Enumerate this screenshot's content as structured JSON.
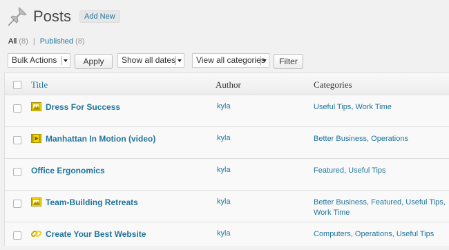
{
  "header": {
    "title": "Posts",
    "add_new": "Add New"
  },
  "views": {
    "all_label": "All",
    "all_count": "(8)",
    "separator": "|",
    "published_label": "Published",
    "published_count": "(8)"
  },
  "toolbar": {
    "bulk_actions": "Bulk Actions",
    "apply": "Apply",
    "dates": "Show all dates",
    "categories": "View all categories",
    "filter": "Filter"
  },
  "columns": {
    "title": "Title",
    "author": "Author",
    "categories": "Categories"
  },
  "posts": [
    {
      "title": "Dress For Success",
      "author": "kyla",
      "categories": "Useful Tips, Work Time",
      "format_icon": "image-format-icon"
    },
    {
      "title": "Manhattan In Motion (video)",
      "author": "kyla",
      "categories": "Better Business, Operations",
      "format_icon": "video-format-icon"
    },
    {
      "title": "Office Ergonomics",
      "author": "kyla",
      "categories": "Featured, Useful Tips",
      "format_icon": ""
    },
    {
      "title": "Team-Building Retreats",
      "author": "kyla",
      "categories": "Better Business, Featured, Useful Tips, Work Time",
      "format_icon": "image-format-icon"
    },
    {
      "title": "Create Your Best Website",
      "author": "kyla",
      "categories": "Computers, Operations, Useful Tips",
      "format_icon": "link-format-icon"
    }
  ],
  "colors": {
    "link": "#21759b",
    "background": "#f1f1f1",
    "format_icon": "#e8c900"
  }
}
